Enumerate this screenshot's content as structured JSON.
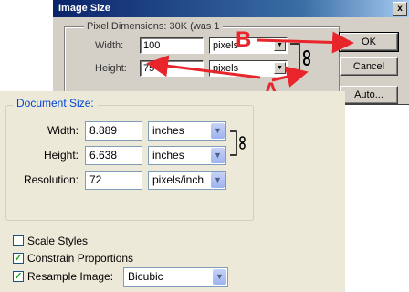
{
  "dialog": {
    "title": "Image Size",
    "close_glyph": "x",
    "pixel_dimensions_label": "Pixel Dimensions:  30K (was 1",
    "width_label": "Width:",
    "width_value": "100",
    "width_unit": "pixels",
    "height_label": "Height:",
    "height_value": "75",
    "height_unit": "pixels",
    "buttons": {
      "ok": "OK",
      "cancel": "Cancel",
      "auto": "Auto..."
    }
  },
  "annotations": {
    "a_label": "A",
    "b_label": "B",
    "arrow_color": "#e8252b"
  },
  "document_size": {
    "legend": "Document Size:",
    "width_label": "Width:",
    "width_value": "8.889",
    "width_unit": "inches",
    "height_label": "Height:",
    "height_value": "6.638",
    "height_unit": "inches",
    "resolution_label": "Resolution:",
    "resolution_value": "72",
    "resolution_unit": "pixels/inch"
  },
  "options": {
    "scale_styles": {
      "label": "Scale Styles",
      "checked": false
    },
    "constrain_proportions": {
      "label": "Constrain Proportions",
      "checked": true
    },
    "resample_image": {
      "label": "Resample Image:",
      "checked": true,
      "method": "Bicubic"
    }
  },
  "icons": {
    "chain": "chain-link-icon",
    "dropdown": "chevron-down-icon",
    "check": "checkmark-icon"
  }
}
